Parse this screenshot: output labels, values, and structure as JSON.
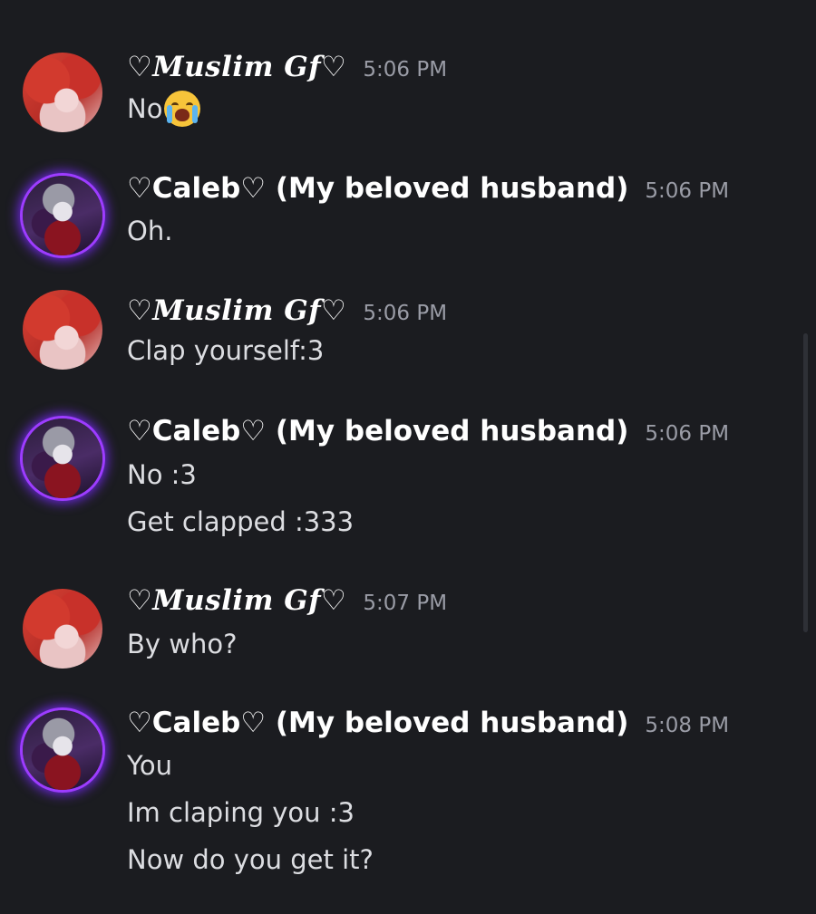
{
  "messages": [
    {
      "author": "♡𝑴𝒖𝒔𝒍𝒊𝒎 𝑮𝒇♡",
      "time": "5:06 PM",
      "lines": [
        "No"
      ],
      "emoji": "loudly-crying-face-icon"
    },
    {
      "author": "♡Caleb♡ (My beloved husband)",
      "time": "5:06 PM",
      "lines": [
        "Oh."
      ]
    },
    {
      "author": "♡𝑴𝒖𝒔𝒍𝒊𝒎 𝑮𝒇♡",
      "time": "5:06 PM",
      "lines": [
        "Clap yourself:3"
      ]
    },
    {
      "author": "♡Caleb♡ (My beloved husband)",
      "time": "5:06 PM",
      "lines": [
        "No :3",
        "Get clapped :333"
      ]
    },
    {
      "author": "♡𝑴𝒖𝒔𝒍𝒊𝒎 𝑮𝒇♡",
      "time": "5:07 PM",
      "lines": [
        "By who?"
      ]
    },
    {
      "author": "♡Caleb♡ (My beloved husband)",
      "time": "5:08 PM",
      "lines": [
        "You",
        "Im claping you :3",
        "Now do you get it?"
      ]
    }
  ],
  "colors": {
    "background": "#1b1c20",
    "username": "#ffffff",
    "timestamp": "#9a9ca6",
    "message_text": "#dcdde1",
    "avatar_ring": "#9d3cff"
  }
}
